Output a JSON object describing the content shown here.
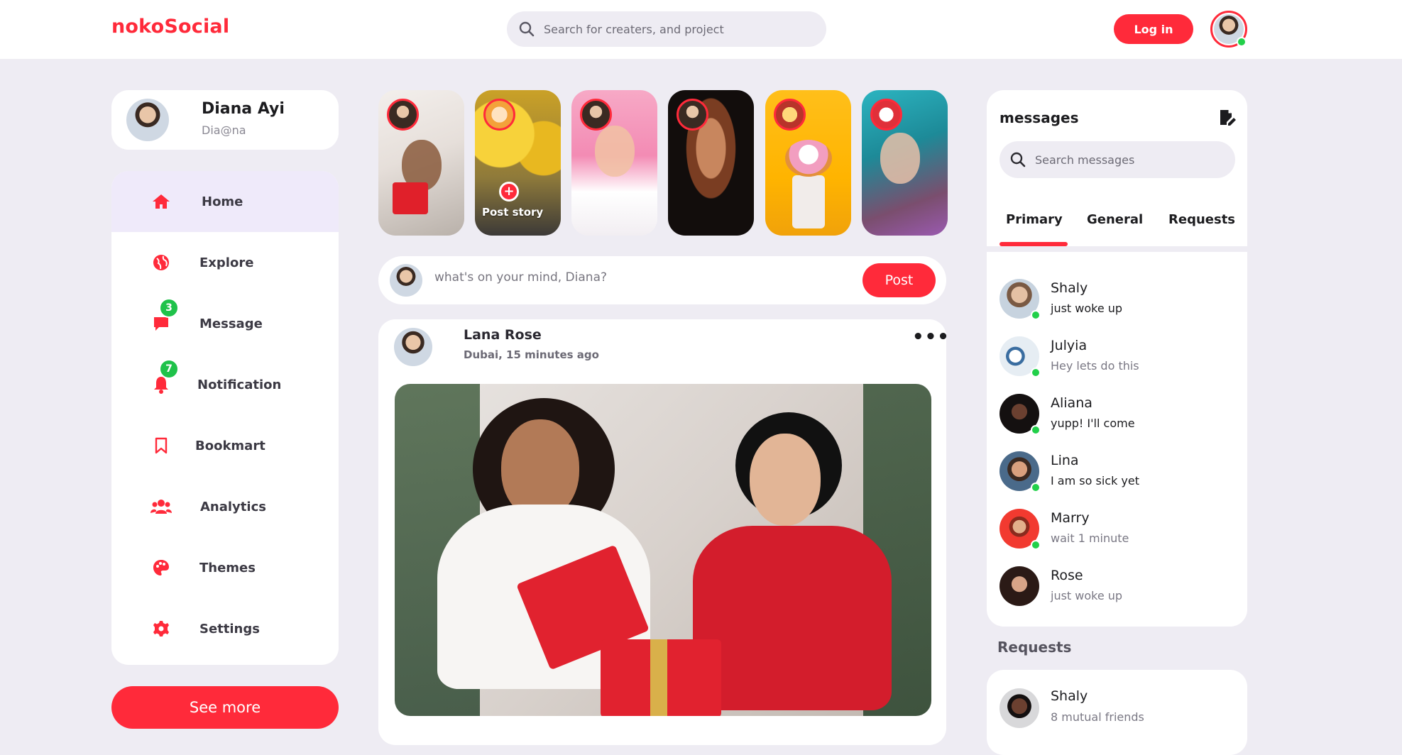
{
  "app": {
    "logo": "nokoSocial"
  },
  "header": {
    "search_placeholder": "Search for creaters, and project",
    "login_label": "Log in"
  },
  "profile": {
    "name": "Diana Ayi",
    "handle": "Dia@na"
  },
  "sidebar": {
    "items": [
      {
        "label": "Home",
        "icon": "home-icon"
      },
      {
        "label": "Explore",
        "icon": "globe-icon"
      },
      {
        "label": "Message",
        "icon": "message-icon",
        "badge": "3"
      },
      {
        "label": "Notification",
        "icon": "bell-icon",
        "badge": "7"
      },
      {
        "label": "Bookmart",
        "icon": "bookmark-icon"
      },
      {
        "label": "Analytics",
        "icon": "users-icon"
      },
      {
        "label": "Themes",
        "icon": "palette-icon"
      },
      {
        "label": "Settings",
        "icon": "gear-icon"
      }
    ],
    "see_more_label": "See more"
  },
  "stories": {
    "post_story_label": "Post story"
  },
  "composer": {
    "placeholder": "what's on your mind, Diana?",
    "post_label": "Post"
  },
  "feed": {
    "author": "Lana Rose",
    "meta": "Dubai, 15 minutes ago",
    "more": "•••"
  },
  "messages": {
    "title": "messages",
    "search_placeholder": "Search messages",
    "tabs": [
      "Primary",
      "General",
      "Requests"
    ],
    "items": [
      {
        "name": "Shaly",
        "text": "just woke up",
        "online": true
      },
      {
        "name": "Julyia",
        "text": "Hey lets do this",
        "online": true
      },
      {
        "name": "Aliana",
        "text": "yupp! I'll come",
        "online": true
      },
      {
        "name": "Lina",
        "text": "I am so sick yet",
        "online": true
      },
      {
        "name": "Marry",
        "text": "wait 1 minute",
        "online": true
      },
      {
        "name": "Rose",
        "text": "just woke up",
        "online": false
      }
    ]
  },
  "requests": {
    "heading": "Requests",
    "items": [
      {
        "name": "Shaly",
        "text": "8 mutual friends"
      }
    ]
  },
  "colors": {
    "accent": "#ff2a3a",
    "online": "#22d04a",
    "background": "#eeecf3"
  }
}
